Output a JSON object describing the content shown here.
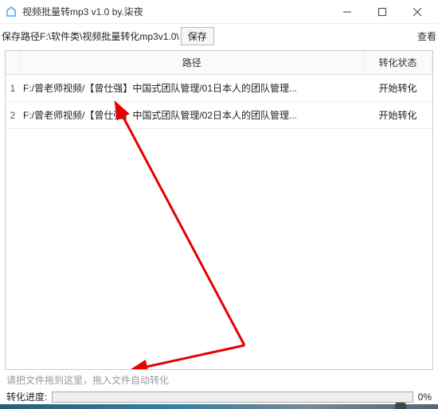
{
  "window": {
    "title": "视频批量转mp3 v1.0  by.柒夜"
  },
  "toolbar": {
    "save_path_label": "保存路径",
    "save_path_value": "F:\\软件类\\视频批量转化mp3v1.0\\",
    "save_button": "保存",
    "right_fragment": "查看"
  },
  "table": {
    "headers": {
      "path": "路径",
      "status": "转化状态"
    },
    "rows": [
      {
        "idx": "1",
        "path": "F:/曾老师视频/【曾仕强】中国式团队管理/01日本人的团队管理...",
        "status": "开始转化"
      },
      {
        "idx": "2",
        "path": "F:/曾老师视频/【曾仕强】中国式团队管理/02日本人的团队管理...",
        "status": "开始转化"
      }
    ]
  },
  "hint": "请把文件拖到这里，拖入文件自动转化",
  "progress": {
    "label": "转化进度:",
    "percent_text": "0%",
    "value": 0
  }
}
